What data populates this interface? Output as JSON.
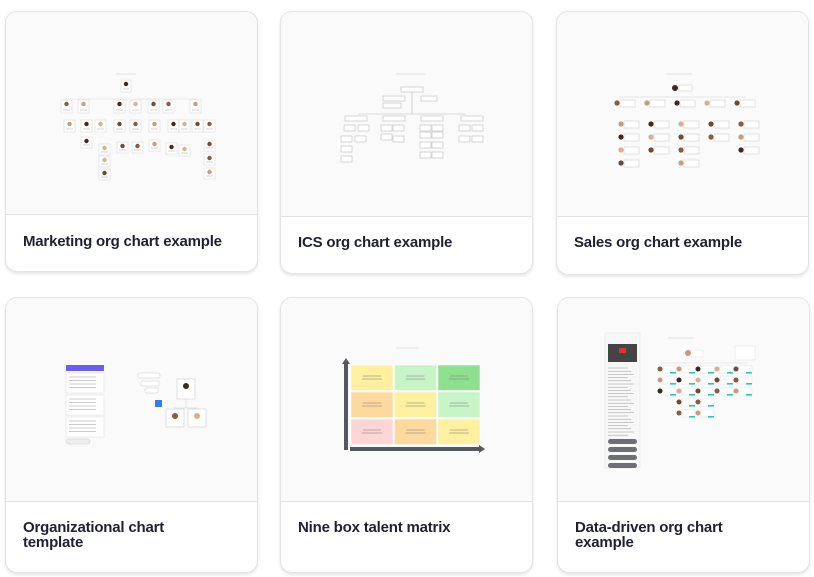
{
  "cards": [
    {
      "title": "Marketing org chart example",
      "thumbnail": "marketing-org-chart-preview"
    },
    {
      "title": "ICS org chart example",
      "thumbnail": "ics-org-chart-preview"
    },
    {
      "title": "Sales org chart example",
      "thumbnail": "sales-org-chart-preview"
    },
    {
      "title": "Organizational chart template",
      "thumbnail": "organizational-chart-template-preview"
    },
    {
      "title": "Nine box talent matrix",
      "thumbnail": "nine-box-matrix-preview"
    },
    {
      "title": "Data-driven org chart example",
      "thumbnail": "data-driven-org-chart-preview"
    }
  ],
  "colors": {
    "title_text": "#1f2130",
    "card_border": "#e3e3e8",
    "thumb_bg": "#fafafa",
    "accent_purple": "#6b5cf6",
    "accent_blue": "#2f7fe6",
    "accent_teal": "#2cc7b8",
    "nine_box": [
      "#fff0a0",
      "#c8f5c8",
      "#8ee08e",
      "#fdd9a0",
      "#fff0a0",
      "#c8f5c8",
      "#fdd5d5",
      "#fdd9a0",
      "#fff0a0"
    ]
  }
}
